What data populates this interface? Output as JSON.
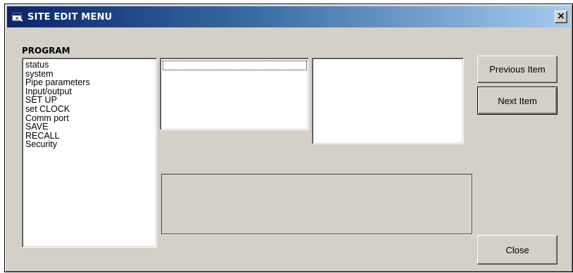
{
  "window": {
    "title": "SITE EDIT MENU",
    "close_glyph": "×"
  },
  "program": {
    "label": "PROGRAM",
    "items": [
      {
        "label": "status"
      },
      {
        "label": "system"
      },
      {
        "label": "Pipe parameters"
      },
      {
        "label": "Input/output"
      },
      {
        "label": "SET UP"
      },
      {
        "label": "set CLOCK"
      },
      {
        "label": "Comm port"
      },
      {
        "label": "SAVE"
      },
      {
        "label": "RECALL"
      },
      {
        "label": "Security"
      }
    ]
  },
  "buttons": {
    "previous": "Previous Item",
    "next": "Next Item",
    "close": "Close"
  },
  "icons": {
    "title": "app-window-icon",
    "close": "close-icon"
  },
  "colors": {
    "titlebar_start": "#0a246a",
    "titlebar_end": "#a6caf0",
    "face": "#d4d0c8"
  }
}
